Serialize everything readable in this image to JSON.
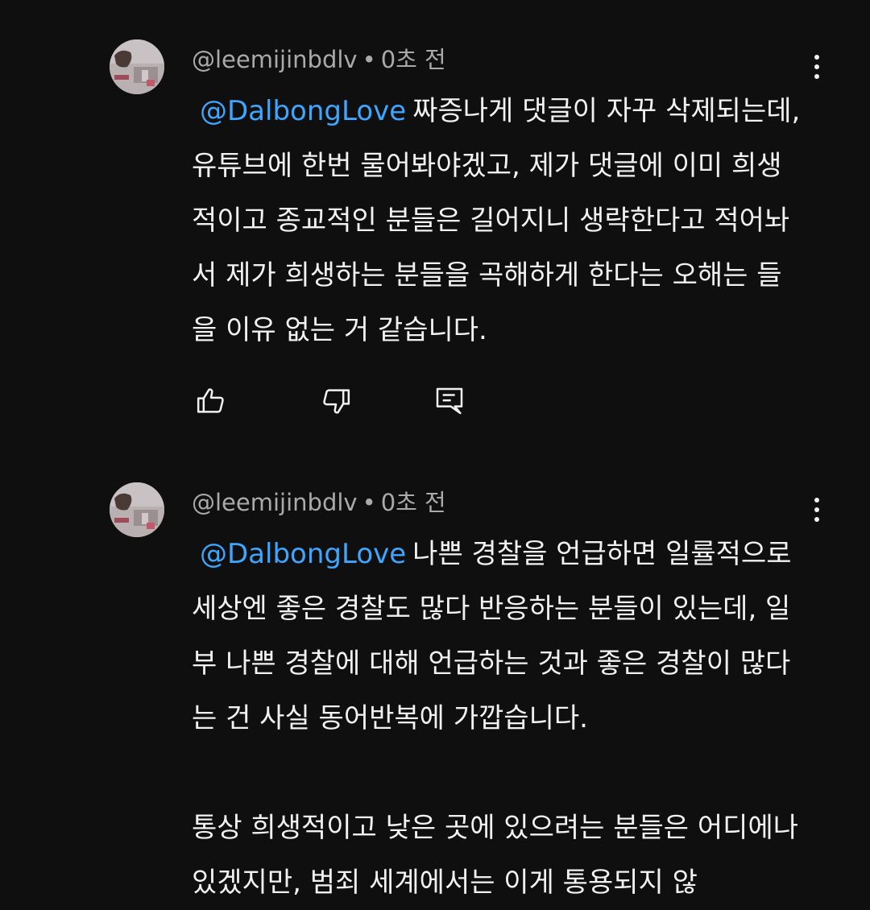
{
  "comments": [
    {
      "author": "@leemijinbdlv",
      "separator": "•",
      "time": "0초 전",
      "mention": "@DalbongLove",
      "paragraphs": [
        "짜증나게 댓글이 자꾸 삭제되는데, 유튜브에 한번 물어봐야겠고, 제가 댓글에 이미 희생적이고 종교적인 분들은 길어지니 생략한다고 적어놔서 제가 희생하는 분들을 곡해하게 한다는 오해는 들을 이유 없는 거 같습니다."
      ],
      "actions": {
        "like_icon": "thumbs-up-icon",
        "dislike_icon": "thumbs-down-icon",
        "reply_icon": "reply-icon"
      }
    },
    {
      "author": "@leemijinbdlv",
      "separator": "•",
      "time": "0초 전",
      "mention": "@DalbongLove",
      "paragraphs": [
        "나쁜 경찰을 언급하면 일률적으로 세상엔 좋은 경찰도 많다 반응하는 분들이 있는데, 일부 나쁜 경찰에 대해 언급하는 것과 좋은 경찰이 많다는 건 사실 동어반복에 가깝습니다.",
        "통상 희생적이고 낮은 곳에 있으려는 분들은 어디에나 있겠지만, 범죄 세계에서는 이게 통용되지 않"
      ]
    }
  ],
  "colors": {
    "background": "#0f0f0f",
    "text": "#f1f1f1",
    "meta": "#aaaaaa",
    "mention": "#3ea6ff"
  }
}
